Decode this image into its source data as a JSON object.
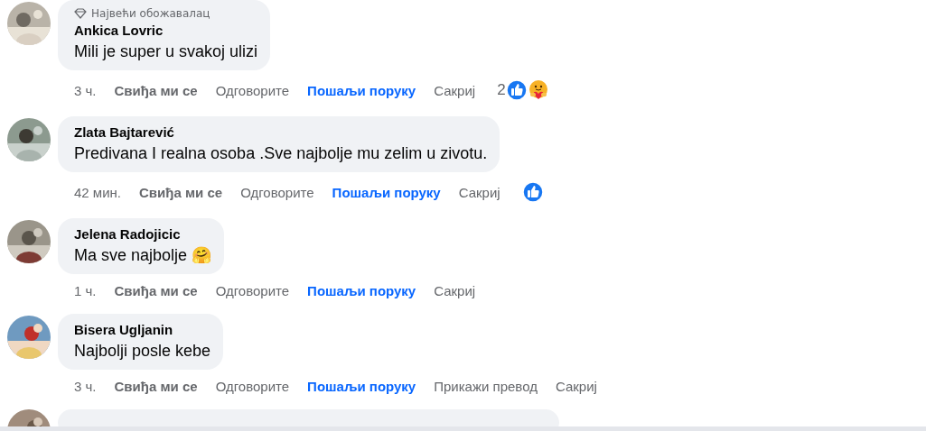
{
  "comments": [
    {
      "kind": "full",
      "badge": "Највећи обожавалац",
      "author": "Ankica Lovric",
      "text": "Mili je super u svakoj ulizi",
      "actions": [
        {
          "kind": "time",
          "label": "3 ч."
        },
        {
          "kind": "like",
          "label": "Свиђа ми се"
        },
        {
          "kind": "plain",
          "label": "Одговорите"
        },
        {
          "kind": "link",
          "label": "Пошаљи поруку"
        },
        {
          "kind": "plain",
          "label": "Сакриј"
        }
      ],
      "reactions": {
        "count": "2",
        "icons": [
          {
            "kind": "like"
          },
          {
            "kind": "care"
          }
        ]
      }
    },
    {
      "kind": "full",
      "author": "Zlata Bajtarević",
      "text": "Predivana I realna osoba .Sve najbolje mu zelim u zivotu.",
      "actions": [
        {
          "kind": "time",
          "label": "42 мин."
        },
        {
          "kind": "like",
          "label": "Свиђа ми се"
        },
        {
          "kind": "plain",
          "label": "Одговорите"
        },
        {
          "kind": "link",
          "label": "Пошаљи поруку"
        },
        {
          "kind": "plain",
          "label": "Сакриј"
        }
      ],
      "reactions": {
        "icons": [
          {
            "kind": "like"
          }
        ]
      }
    },
    {
      "kind": "full",
      "author": "Jelena Radojicic",
      "text": "Ma sve najbolje 🤗",
      "actions": [
        {
          "kind": "time",
          "label": "1 ч."
        },
        {
          "kind": "like",
          "label": "Свиђа ми се"
        },
        {
          "kind": "plain",
          "label": "Одговорите"
        },
        {
          "kind": "link",
          "label": "Пошаљи поруку"
        },
        {
          "kind": "plain",
          "label": "Сакриј"
        }
      ]
    },
    {
      "kind": "full",
      "author": "Bisera Ugljanin",
      "text": "Najbolji posle kebe",
      "actions": [
        {
          "kind": "time",
          "label": "3 ч."
        },
        {
          "kind": "like",
          "label": "Свиђа ми се"
        },
        {
          "kind": "plain",
          "label": "Одговорите"
        },
        {
          "kind": "link",
          "label": "Пошаљи поруку"
        },
        {
          "kind": "plain",
          "label": "Прикажи превод"
        },
        {
          "kind": "plain",
          "label": "Сакриј"
        }
      ]
    },
    {
      "kind": "partial"
    }
  ]
}
